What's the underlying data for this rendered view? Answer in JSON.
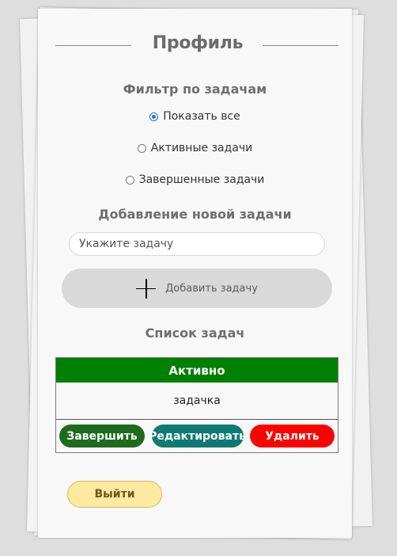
{
  "page": {
    "title": "Профиль"
  },
  "filter": {
    "heading": "Фильтр по задачам",
    "options": [
      {
        "label": "Показать все",
        "checked": true
      },
      {
        "label": "Активные задачи",
        "checked": false
      },
      {
        "label": "Завершенные задачи",
        "checked": false
      }
    ]
  },
  "add_task": {
    "heading": "Добавление новой задачи",
    "input_placeholder": "Укажите задачу",
    "input_value": "",
    "button_label": "Добавить задачу"
  },
  "task_list": {
    "heading": "Список задач",
    "tasks": [
      {
        "status": "Активно",
        "name": "задачка",
        "actions": {
          "complete": "Завершить",
          "edit": "Редактировать",
          "delete": "Удалить"
        }
      }
    ]
  },
  "logout_label": "Выйти",
  "colors": {
    "status_active": "#008000",
    "complete_button": "#1e6b1e",
    "edit_button": "#0f7a73",
    "delete_button": "#ff0000",
    "logout_button": "#fde9a0",
    "add_button": "#d9d9d9"
  }
}
